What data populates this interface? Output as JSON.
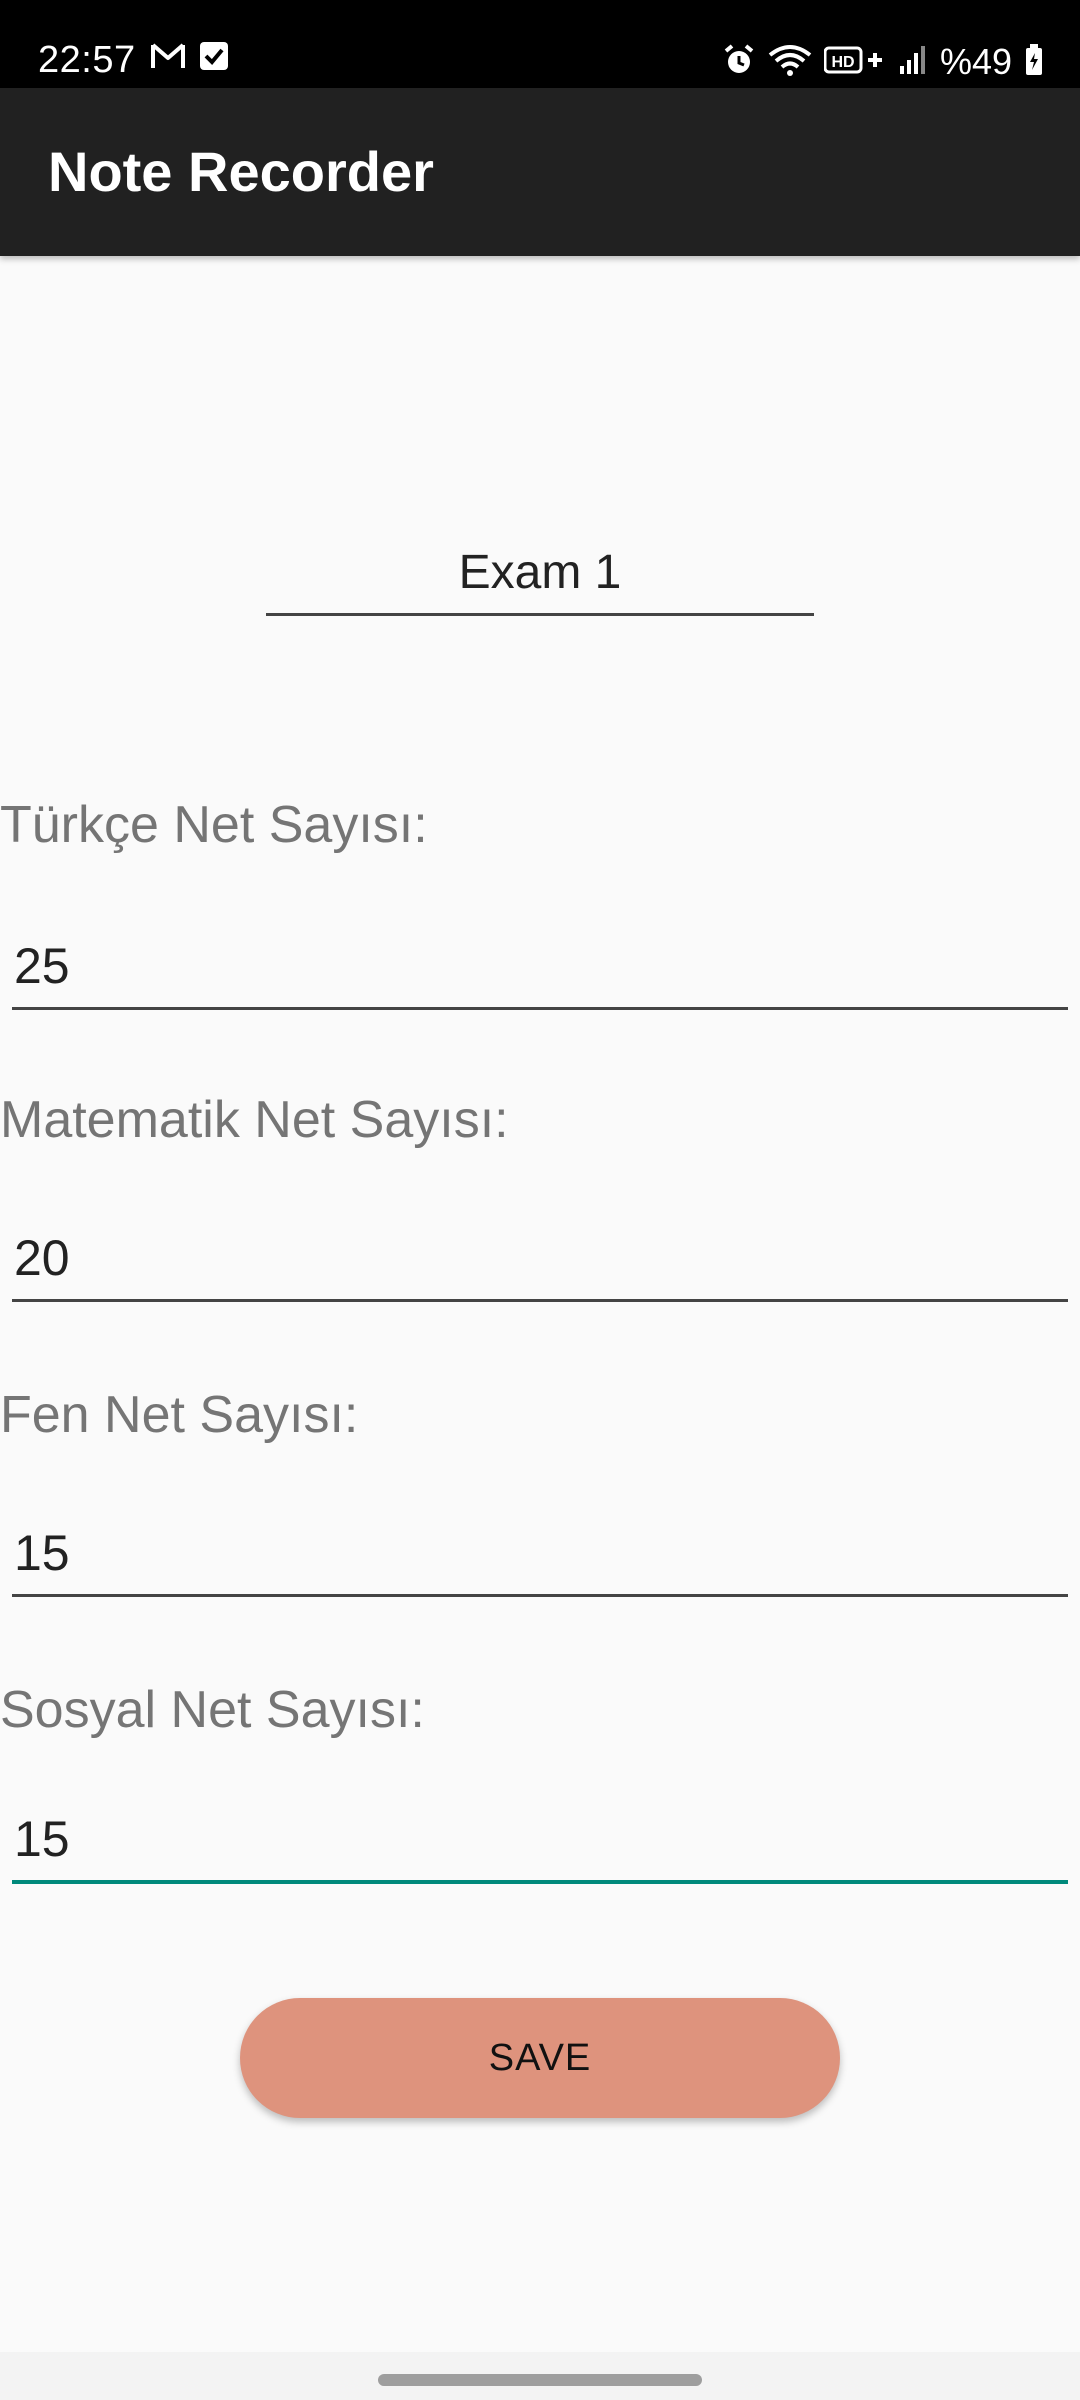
{
  "status_bar": {
    "time": "22:57",
    "battery": "%49",
    "icons_left": [
      "gmail-icon",
      "checkbox-notification-icon"
    ],
    "icons_right": [
      "alarm-icon",
      "wifi-icon",
      "hd-volte-icon",
      "signal-icon",
      "battery-icon"
    ]
  },
  "app_bar": {
    "title": "Note Recorder",
    "background": "#212121"
  },
  "form": {
    "exam_name_value": "Exam 1",
    "fields": [
      {
        "label": "Türkçe Net Sayısı:",
        "value": "25"
      },
      {
        "label": "Matematik Net Sayısı:",
        "value": "20"
      },
      {
        "label": "Fen Net Sayısı:",
        "value": "15"
      },
      {
        "label": "Sosyal Net Sayısı:",
        "value": "15"
      }
    ],
    "focused_underline_color": "#00897b",
    "save_label": "SAVE",
    "save_color": "#de937d"
  }
}
